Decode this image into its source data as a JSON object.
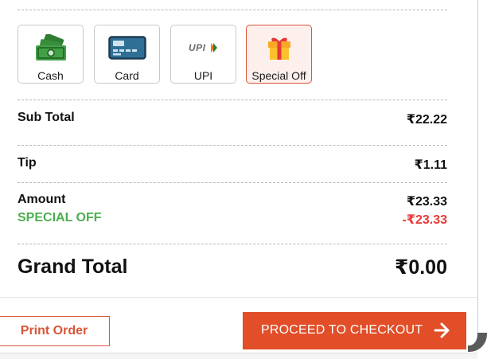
{
  "payment_methods": [
    {
      "label": "Cash",
      "icon": "cash-icon",
      "selected": false
    },
    {
      "label": "Card",
      "icon": "card-icon",
      "selected": false
    },
    {
      "label": "UPI",
      "icon": "upi-icon",
      "selected": false
    },
    {
      "label": "Special Off",
      "icon": "gift-icon",
      "selected": true
    }
  ],
  "upi_logo_text": "UPI",
  "summary": {
    "sub_total_label": "Sub Total",
    "sub_total_value": "₹22.22",
    "tip_label": "Tip",
    "tip_value": "₹1.11",
    "amount_label": "Amount",
    "amount_value": "₹23.33",
    "special_off_label": "SPECIAL OFF",
    "special_off_value": "-₹23.33",
    "grand_total_label": "Grand Total",
    "grand_total_value": "₹0.00"
  },
  "actions": {
    "print_label": "Print Order",
    "checkout_label": "PROCEED TO CHECKOUT",
    "checkout_icon": "arrow-right-icon"
  },
  "colors": {
    "accent": "#e14e28",
    "selected_border": "#d9553a",
    "selected_bg": "#fdf0ec",
    "discount_label": "#4caf50",
    "discount_value": "#e53935"
  }
}
